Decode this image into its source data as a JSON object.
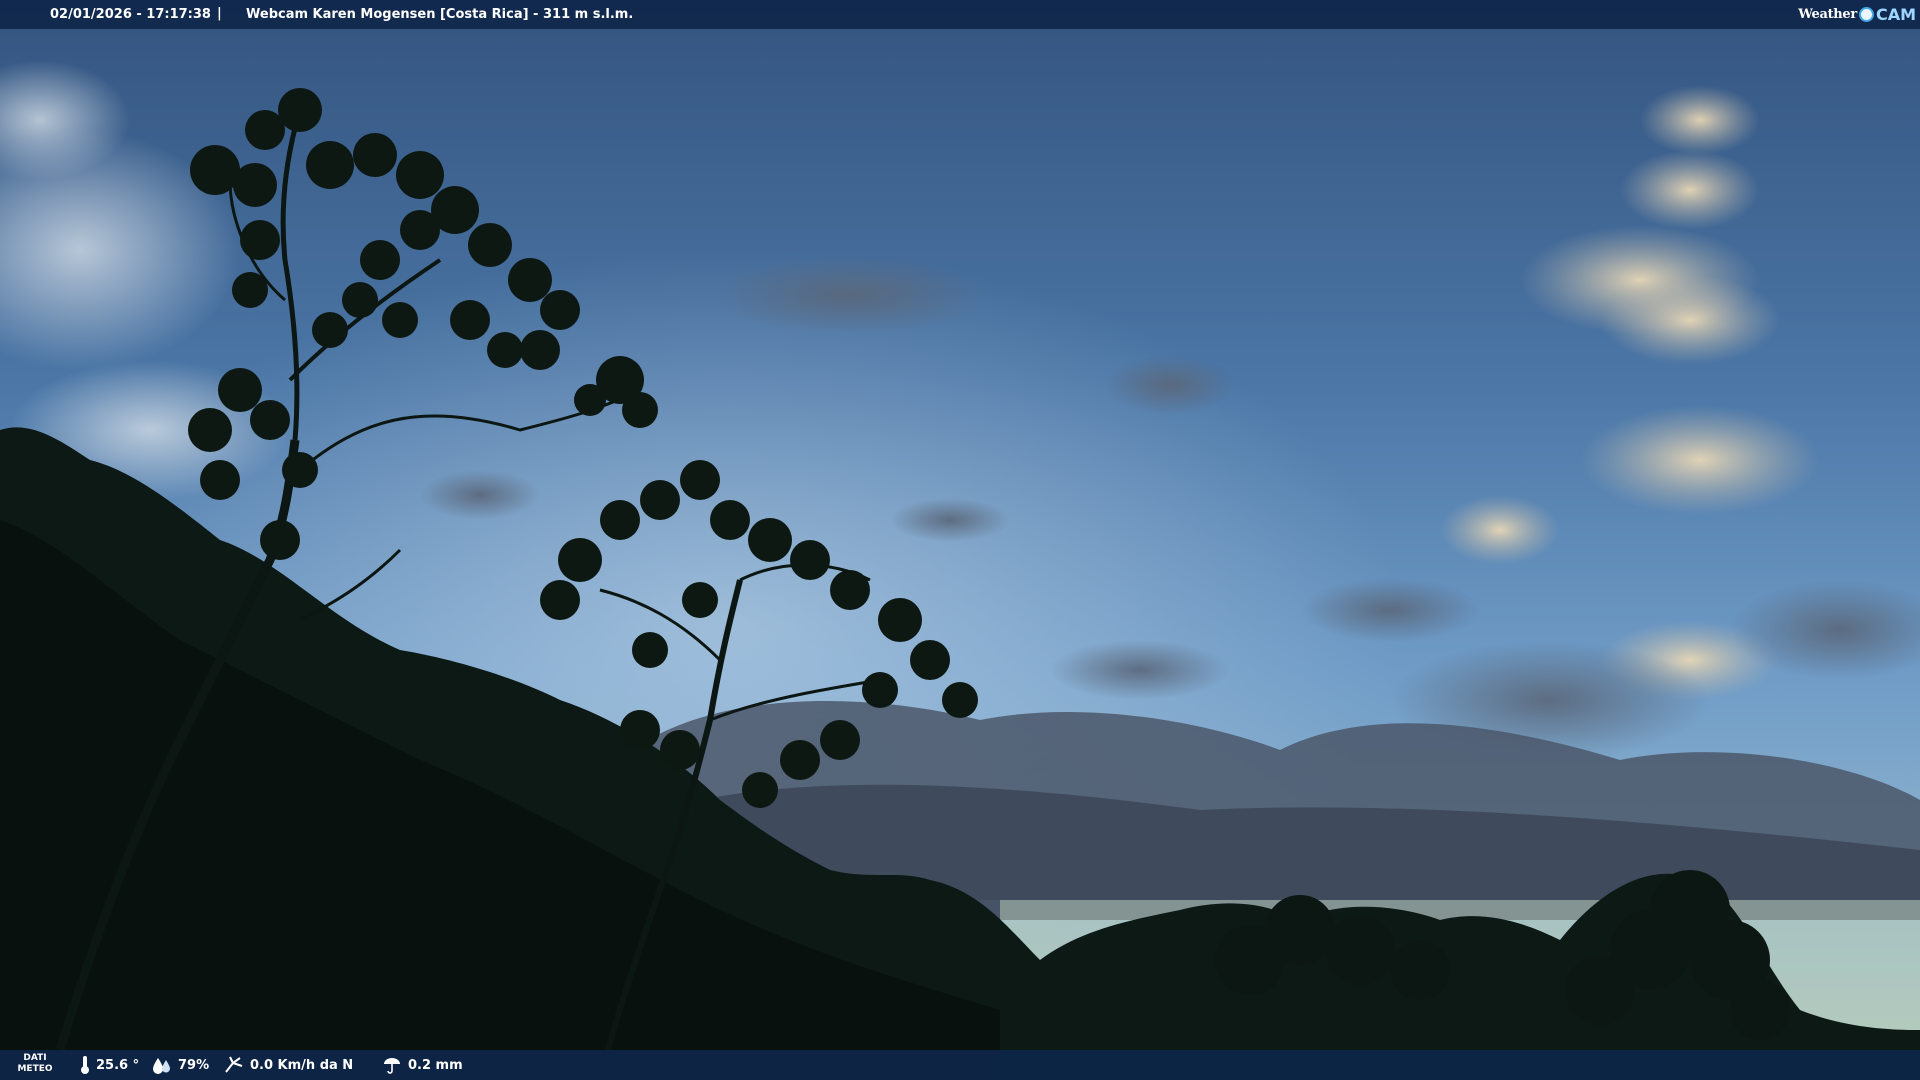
{
  "header": {
    "datetime": "02/01/2026 - 17:17:38",
    "separator": "|",
    "title": "Webcam Karen Mogensen [Costa Rica] - 311 m s.l.m.",
    "logo": {
      "word": "Weather",
      "cam": "CAM"
    }
  },
  "footer": {
    "label_line1": "DATI",
    "label_line2": "METEO",
    "temperature": "25.6 °",
    "humidity": "79%",
    "wind": "0.0 Km/h da N",
    "rain": "0.2 mm",
    "icons": [
      "thermometer-icon",
      "humidity-icon",
      "wind-icon",
      "rain-icon"
    ]
  },
  "colors": {
    "bar_bg": "#0e264a",
    "sky_top": "#3b5f90",
    "sky_horizon": "#a9c4bf",
    "vegetation": "#0b1814"
  }
}
